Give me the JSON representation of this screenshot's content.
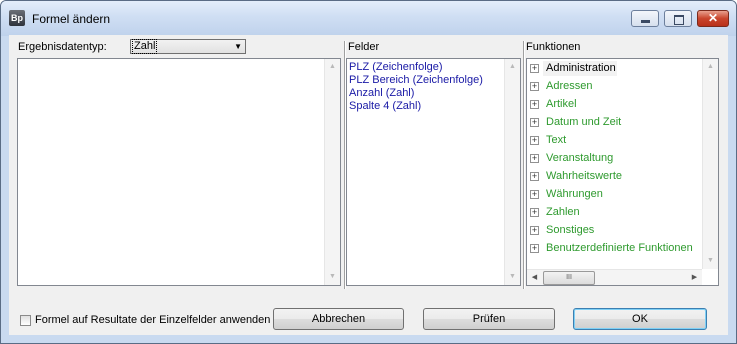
{
  "window": {
    "title": "Formel ändern",
    "app_icon_text": "Bp",
    "controls": {
      "minimize": "minimize-icon",
      "maximize": "maximize-icon",
      "close": "close-icon"
    }
  },
  "left_panel": {
    "result_type_label": "Ergebnisdatentyp:",
    "result_type_value": "Zahl"
  },
  "fields_panel": {
    "label": "Felder",
    "items": [
      "PLZ (Zeichenfolge)",
      "PLZ Bereich (Zeichenfolge)",
      "Anzahl (Zahl)",
      "Spalte 4 (Zahl)"
    ]
  },
  "functions_panel": {
    "label": "Funktionen",
    "items": [
      "Administration",
      "Adressen",
      "Artikel",
      "Datum und Zeit",
      "Text",
      "Veranstaltung",
      "Wahrheitswerte",
      "Währungen",
      "Zahlen",
      "Sonstiges",
      "Benutzerdefinierte Funktionen"
    ],
    "selected_index": 0,
    "hscroll_thumb": "III"
  },
  "footer": {
    "apply_checkbox_label": "Formel auf Resultate der Einzelfelder anwenden",
    "apply_checked": false,
    "cancel_label": "Abbrechen",
    "check_label": "Prüfen",
    "ok_label": "OK"
  },
  "colors": {
    "function_item": "#2e9a2e",
    "field_item": "#1a1aa6",
    "titlebar": "#c9daf0"
  }
}
